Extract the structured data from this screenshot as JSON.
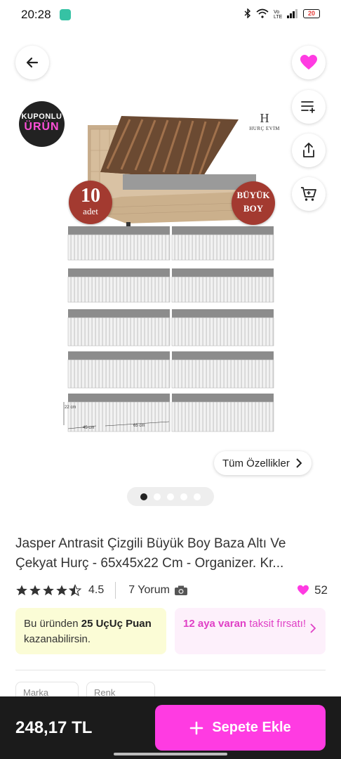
{
  "status_bar": {
    "time": "20:28",
    "battery": "20",
    "icons": [
      "notification-icon",
      "bluetooth-icon",
      "wifi-icon",
      "volte-icon",
      "signal-icon",
      "battery-icon"
    ]
  },
  "product_image": {
    "coupon_badge": {
      "line1": "KUPONLU",
      "line2": "ÜRÜN"
    },
    "brand_logo": "H",
    "brand_name": "HURÇ EVİM",
    "count_badge": {
      "number": "10",
      "unit": "adet"
    },
    "size_badge": {
      "line1": "BÜYÜK",
      "line2": "BOY"
    },
    "dimensions": {
      "height": "22 cm",
      "width": "45 cm",
      "length": "65 cm"
    }
  },
  "features_button": {
    "label": "Tüm Özellikler"
  },
  "carousel": {
    "total": 5,
    "active": 1
  },
  "product": {
    "title": "Jasper Antrasit Çizgili Büyük Boy Baza Altı Ve Çekyat Hurç - 65x45x22 Cm - Organizer. Kr...",
    "rating": "4.5",
    "rating_stars": 4.5,
    "reviews": "7 Yorum",
    "likes": "52"
  },
  "promo": {
    "points_prefix": "Bu üründen ",
    "points_bold": "25 UçUç Puan",
    "points_suffix": " kazanabilirsin.",
    "installment_bold": "12 aya varan",
    "installment_rest": " taksit fırsatı!"
  },
  "attributes": [
    {
      "label": "Marka"
    },
    {
      "label": "Renk"
    }
  ],
  "bottom_bar": {
    "price": "248,17 TL",
    "add_to_cart": "Sepete Ekle"
  },
  "colors": {
    "accent": "#ff3be2",
    "heart": "#ff3be2",
    "points_bg": "#fbfcd6",
    "install_bg": "#fdf0fb",
    "badge_red": "#a33a30"
  }
}
